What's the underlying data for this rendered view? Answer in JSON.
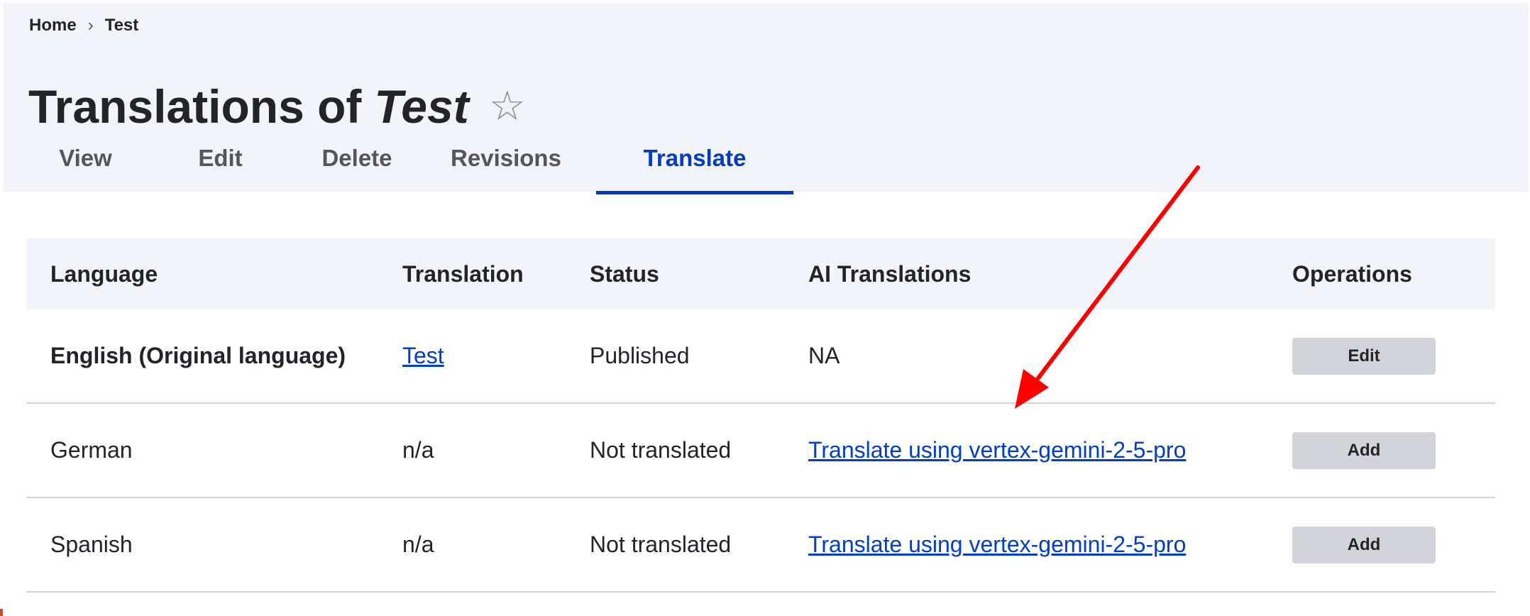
{
  "breadcrumb": {
    "items": [
      "Home",
      "Test"
    ],
    "separator": "›"
  },
  "title": {
    "prefix": "Translations of",
    "entity": "Test",
    "star_icon": "star-icon"
  },
  "tabs": [
    {
      "label": "View",
      "active": false
    },
    {
      "label": "Edit",
      "active": false
    },
    {
      "label": "Delete",
      "active": false
    },
    {
      "label": "Revisions",
      "active": false
    },
    {
      "label": "Translate",
      "active": true
    }
  ],
  "table": {
    "headers": [
      "Language",
      "Translation",
      "Status",
      "AI Translations",
      "Operations"
    ],
    "rows": [
      {
        "language": "English (Original language)",
        "translation": "Test",
        "status": "Published",
        "ai": "NA",
        "operation": "Edit"
      },
      {
        "language": "German",
        "translation": "n/a",
        "status": "Not translated",
        "ai": "Translate using vertex-gemini-2-5-pro",
        "operation": "Add"
      },
      {
        "language": "Spanish",
        "translation": "n/a",
        "status": "Not translated",
        "ai": "Translate using vertex-gemini-2-5-pro",
        "operation": "Add"
      }
    ]
  },
  "colors": {
    "accent": "#003cc5",
    "link": "#003ecc",
    "header_bg": "#f3f4f9",
    "button_bg": "#d3d4d9",
    "annotation_arrow": "#ff0000"
  }
}
